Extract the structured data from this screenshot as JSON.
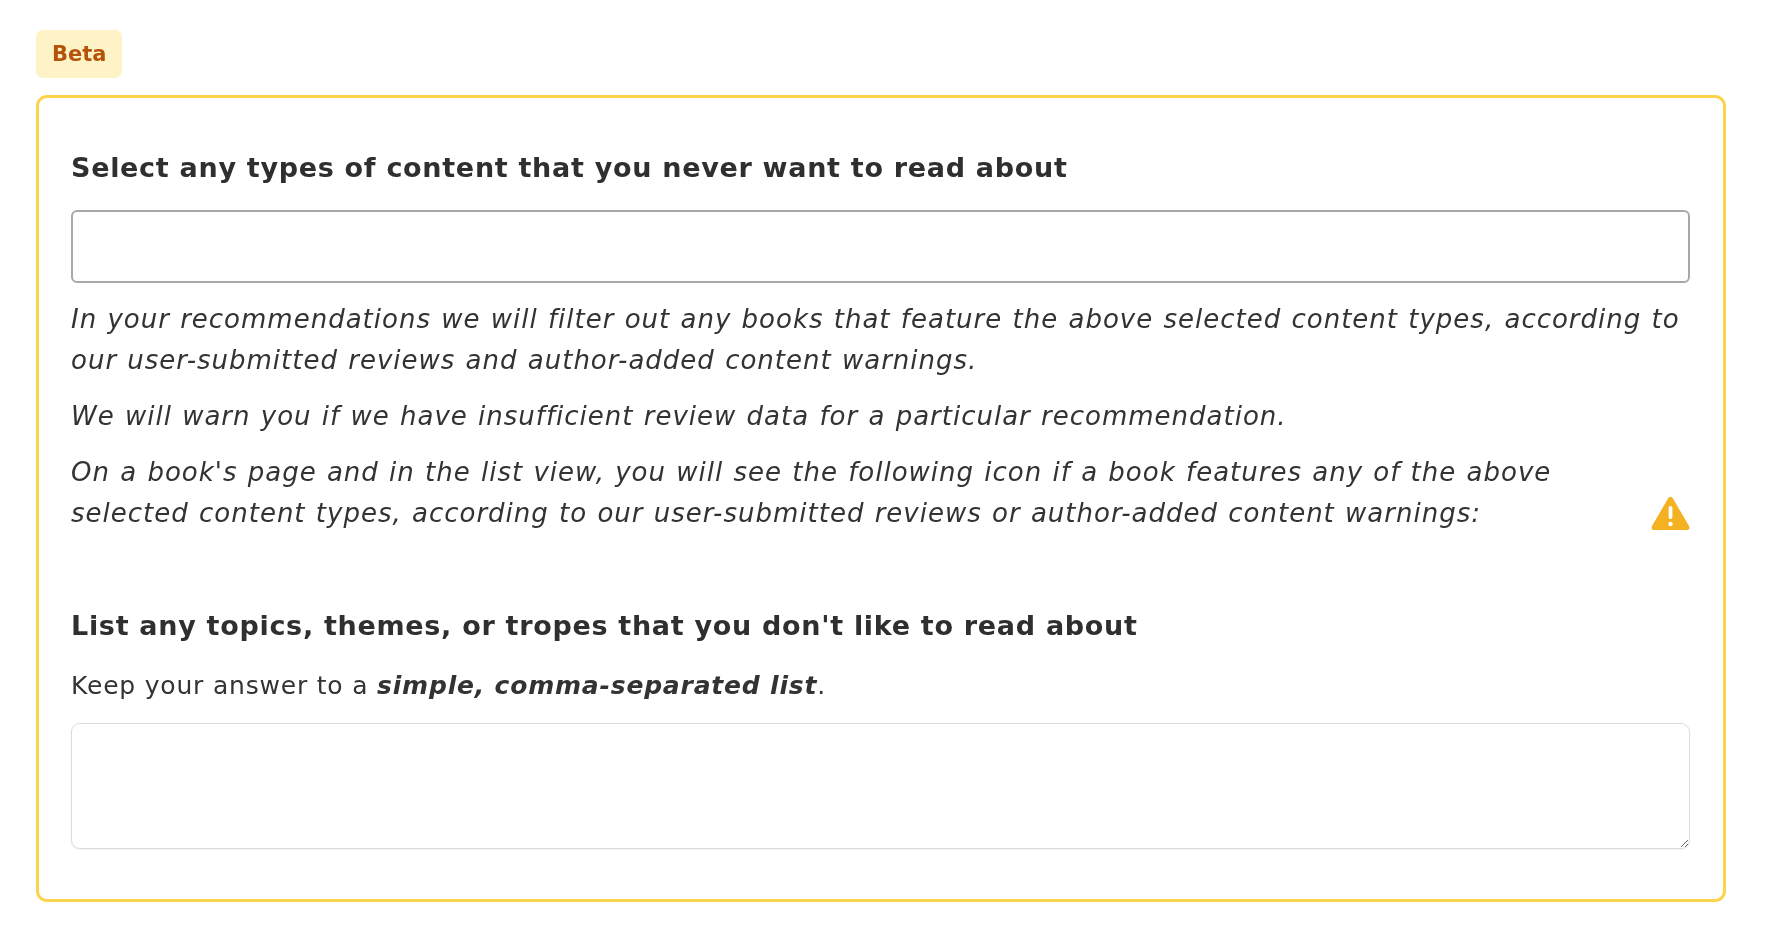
{
  "badge": {
    "label": "Beta"
  },
  "content_filter": {
    "heading": "Select any types of content that you never want to read about",
    "notes": [
      {
        "kind": "plain",
        "text": "In your recommendations we will filter out any books that feature the above selected content types, according to our user-submitted reviews and author-added content warnings."
      },
      {
        "kind": "plain",
        "text": "We will warn you if we have insufficient review data for a particular recommendation."
      },
      {
        "kind": "with_warning_icon",
        "text": "On a book's page and in the list view, you will see the following icon if a book features any of the above selected content types, according to our user-submitted reviews or author-added content warnings:"
      }
    ]
  },
  "topics": {
    "heading": "List any topics, themes, or tropes that you don't like to read about",
    "hint": "Keep your answer to a **simple, comma-separated list**."
  }
}
